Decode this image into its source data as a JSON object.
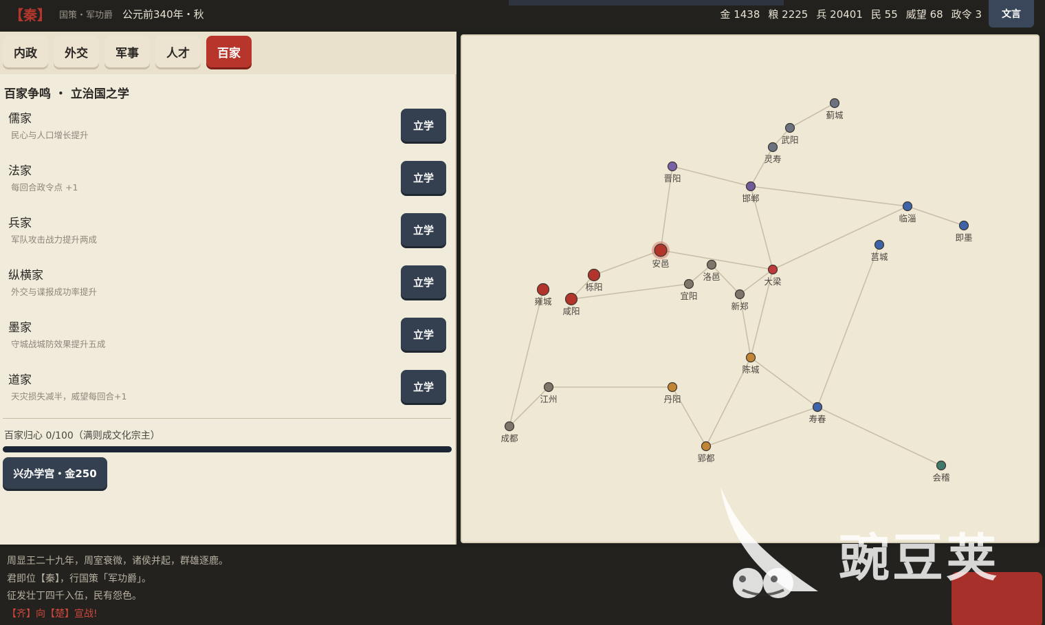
{
  "topbar": {
    "nation": "【秦】",
    "policy": "国策・军功爵",
    "date": "公元前340年・秋",
    "stats": [
      {
        "label": "金",
        "value": "1438"
      },
      {
        "label": "粮",
        "value": "2225"
      },
      {
        "label": "兵",
        "value": "20401"
      },
      {
        "label": "民",
        "value": "55"
      },
      {
        "label": "威望",
        "value": "68"
      },
      {
        "label": "政令",
        "value": "3"
      }
    ],
    "wenyan_label": "文言"
  },
  "tabs": [
    {
      "label": "内政",
      "active": false
    },
    {
      "label": "外交",
      "active": false
    },
    {
      "label": "军事",
      "active": false
    },
    {
      "label": "人才",
      "active": false
    },
    {
      "label": "百家",
      "active": true
    }
  ],
  "section_title": "百家争鸣 ・ 立治国之学",
  "schools": [
    {
      "name": "儒家",
      "desc": "民心与人口增长提升",
      "button": "立学"
    },
    {
      "name": "法家",
      "desc": "每回合政令点 +1",
      "button": "立学"
    },
    {
      "name": "兵家",
      "desc": "军队攻击战力提升两成",
      "button": "立学"
    },
    {
      "name": "纵横家",
      "desc": "外交与谍报成功率提升",
      "button": "立学"
    },
    {
      "name": "墨家",
      "desc": "守城战城防效果提升五成",
      "button": "立学"
    },
    {
      "name": "道家",
      "desc": "天灾损失减半，威望每回合+1",
      "button": "立学"
    }
  ],
  "progress": {
    "label": "百家归心 0/100（满则成文化宗主）",
    "fraction": 1.0
  },
  "academy_button": "兴办学宫・金250",
  "map": {
    "colors": {
      "qin": "#b1352b",
      "jin": "#7a62a8",
      "zhao": "#6f5c9a",
      "yan": "#6b7280",
      "qi": "#3f63a8",
      "han": "#7d776b",
      "wei": "#c0393a",
      "chu": "#c28435",
      "yue": "#3f7a6a"
    },
    "cities": [
      {
        "id": "jicheng",
        "name": "蓟城",
        "color": "yan"
      },
      {
        "id": "wuyang",
        "name": "武阳",
        "color": "yan"
      },
      {
        "id": "lingshou",
        "name": "灵寿",
        "color": "yan"
      },
      {
        "id": "jinyang",
        "name": "晋阳",
        "color": "jin"
      },
      {
        "id": "handan",
        "name": "邯郸",
        "color": "zhao"
      },
      {
        "id": "linzi",
        "name": "临淄",
        "color": "qi"
      },
      {
        "id": "jimo",
        "name": "即墨",
        "color": "qi"
      },
      {
        "id": "jucheng",
        "name": "莒城",
        "color": "qi"
      },
      {
        "id": "anyi",
        "name": "安邑",
        "color": "qin",
        "selected": true
      },
      {
        "id": "luoyi",
        "name": "洛邑",
        "color": "han"
      },
      {
        "id": "daliang",
        "name": "大梁",
        "color": "wei"
      },
      {
        "id": "yueyang",
        "name": "栎阳",
        "color": "qin"
      },
      {
        "id": "yongcheng",
        "name": "雍城",
        "color": "qin"
      },
      {
        "id": "xianyang",
        "name": "咸阳",
        "color": "qin"
      },
      {
        "id": "yiyang",
        "name": "宜阳",
        "color": "han"
      },
      {
        "id": "xinzheng",
        "name": "新郑",
        "color": "han"
      },
      {
        "id": "chencheng",
        "name": "陈城",
        "color": "chu"
      },
      {
        "id": "jiangzhou",
        "name": "江州",
        "color": "han"
      },
      {
        "id": "danyang",
        "name": "丹阳",
        "color": "chu"
      },
      {
        "id": "shouchun",
        "name": "寿春",
        "color": "qi"
      },
      {
        "id": "chengdu",
        "name": "成都",
        "color": "han"
      },
      {
        "id": "yingdu",
        "name": "郢都",
        "color": "chu"
      },
      {
        "id": "kuaiji",
        "name": "会稽",
        "color": "yue"
      }
    ],
    "roads": [
      [
        "jicheng",
        "wuyang"
      ],
      [
        "wuyang",
        "lingshou"
      ],
      [
        "lingshou",
        "handan"
      ],
      [
        "jinyang",
        "handan"
      ],
      [
        "jinyang",
        "anyi"
      ],
      [
        "handan",
        "linzi"
      ],
      [
        "handan",
        "daliang"
      ],
      [
        "linzi",
        "jimo"
      ],
      [
        "linzi",
        "daliang"
      ],
      [
        "jucheng",
        "shouchun"
      ],
      [
        "anyi",
        "yueyang"
      ],
      [
        "anyi",
        "daliang"
      ],
      [
        "luoyi",
        "xinzheng"
      ],
      [
        "daliang",
        "xinzheng"
      ],
      [
        "yueyang",
        "xianyang"
      ],
      [
        "xianyang",
        "yiyang"
      ],
      [
        "yongcheng",
        "chengdu"
      ],
      [
        "yiyang",
        "luoyi"
      ],
      [
        "xinzheng",
        "chencheng"
      ],
      [
        "daliang",
        "chencheng"
      ],
      [
        "chencheng",
        "shouchun"
      ],
      [
        "chencheng",
        "yingdu"
      ],
      [
        "jiangzhou",
        "danyang"
      ],
      [
        "jiangzhou",
        "chengdu"
      ],
      [
        "danyang",
        "yingdu"
      ],
      [
        "yingdu",
        "shouchun"
      ],
      [
        "shouchun",
        "kuaiji"
      ]
    ]
  },
  "log": [
    {
      "text": "周显王二十九年，周室衰微，诸侯并起，群雄逐鹿。",
      "type": "normal"
    },
    {
      "text": "君即位【秦】，行国策「军功爵」。",
      "type": "normal"
    },
    {
      "text": "征发壮丁四千入伍，民有怨色。",
      "type": "normal"
    },
    {
      "text": "【齐】向【楚】宣战!",
      "type": "war"
    }
  ],
  "watermark": "豌豆荚"
}
